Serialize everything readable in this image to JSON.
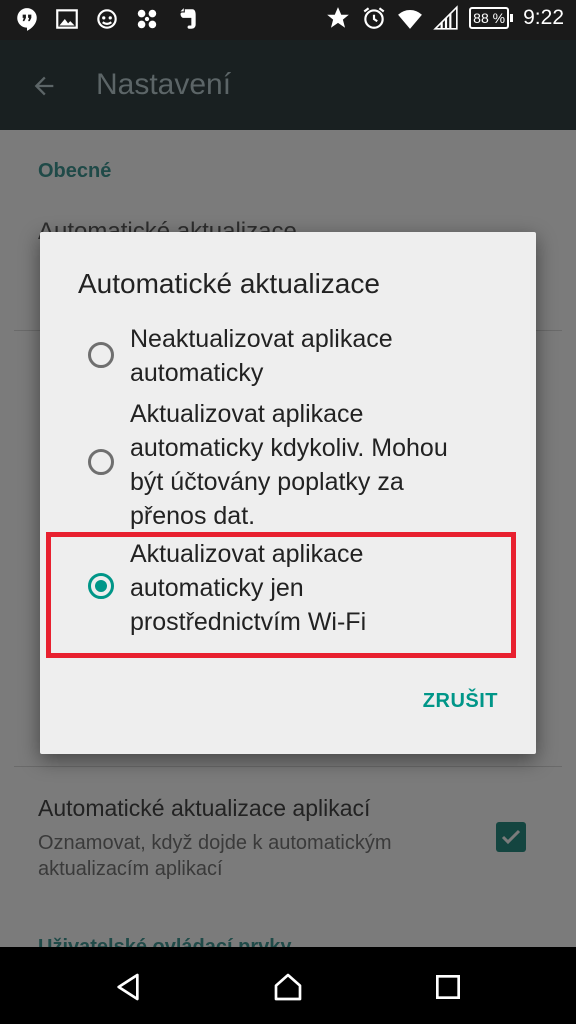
{
  "statusbar": {
    "battery": "88 %",
    "time": "9:22",
    "icons_left": [
      "hangouts-icon",
      "image-icon",
      "monkey-icon",
      "pinwheel-icon",
      "evernote-icon"
    ],
    "icons_right": [
      "star-icon",
      "alarm-icon",
      "wifi-icon",
      "signal-icon",
      "battery-icon"
    ]
  },
  "appbar": {
    "title": "Nastavení"
  },
  "background": {
    "section_general": "Obecné",
    "item_auto_updates": "Automatické aktualizace",
    "item_app_updates_title": "Automatické aktualizace aplikací",
    "item_app_updates_subtitle": "Oznamovat, když dojde k automatickým aktualizacím aplikací",
    "item_app_updates_checked": true,
    "section_user": "Uživatelské ovládací prvky"
  },
  "dialog": {
    "title": "Automatické aktualizace",
    "options": [
      {
        "label": "Neaktualizovat aplikace automaticky",
        "selected": false
      },
      {
        "label": "Aktualizovat aplikace automaticky kdykoliv. Mohou být účtovány poplatky za přenos dat.",
        "selected": false
      },
      {
        "label": "Aktualizovat aplikace automaticky jen prostřednictvím Wi-Fi",
        "selected": true
      }
    ],
    "cancel_label": "ZRUŠIT"
  },
  "colors": {
    "accent": "#009688",
    "highlight": "#e8202f"
  }
}
